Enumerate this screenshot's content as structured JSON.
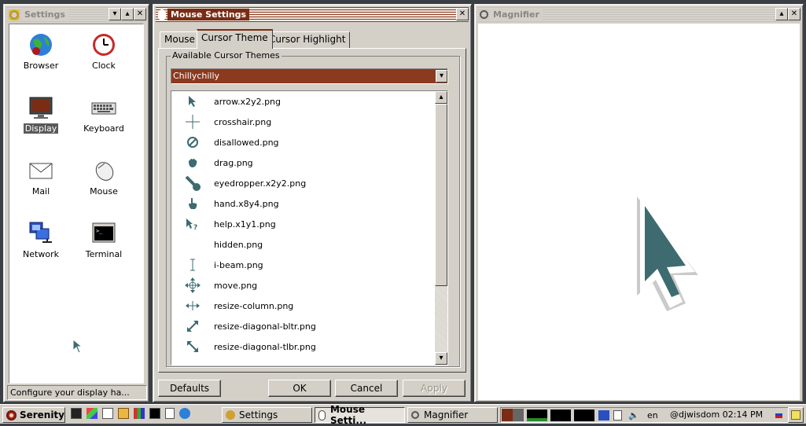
{
  "colors": {
    "accent": "#7a2c14",
    "cursor_fill": "#3d6b70",
    "combo_bg": "#8b3a1f"
  },
  "settings": {
    "title": "Settings",
    "items": [
      {
        "label": "Browser",
        "icon": "globe-icon"
      },
      {
        "label": "Clock",
        "icon": "clock-icon"
      },
      {
        "label": "Display",
        "icon": "monitor-icon"
      },
      {
        "label": "Keyboard",
        "icon": "keyboard-icon"
      },
      {
        "label": "Mail",
        "icon": "envelope-icon"
      },
      {
        "label": "Mouse",
        "icon": "mouse-icon"
      },
      {
        "label": "Network",
        "icon": "network-icon"
      },
      {
        "label": "Terminal",
        "icon": "terminal-icon"
      }
    ],
    "status": "Configure your display ha..."
  },
  "mouse": {
    "title": "Mouse Settings",
    "tabs": [
      "Mouse",
      "Cursor Theme",
      "Cursor Highlight"
    ],
    "group_label": "Available Cursor Themes",
    "theme_selected": "Chillychilly",
    "files": [
      "arrow.x2y2.png",
      "crosshair.png",
      "disallowed.png",
      "drag.png",
      "eyedropper.x2y2.png",
      "hand.x8y4.png",
      "help.x1y1.png",
      "hidden.png",
      "i-beam.png",
      "move.png",
      "resize-column.png",
      "resize-diagonal-bltr.png",
      "resize-diagonal-tlbr.png"
    ],
    "buttons": {
      "defaults": "Defaults",
      "ok": "OK",
      "cancel": "Cancel",
      "apply": "Apply"
    }
  },
  "magnifier": {
    "title": "Magnifier"
  },
  "taskbar": {
    "start": "Serenity",
    "tasks": [
      "Settings",
      "Mouse Setti...",
      "Magnifier"
    ],
    "lang": "en",
    "clock": "@djwisdom 02:14 PM"
  }
}
